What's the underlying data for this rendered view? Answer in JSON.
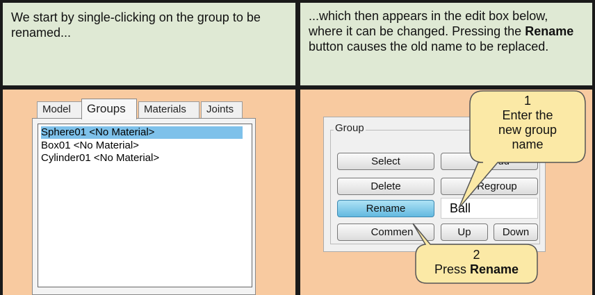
{
  "left_caption": "We start by single-clicking on the group to be renamed...",
  "right_caption": {
    "part1": "...which then appears in the edit box below, where it can be changed. Pressing the ",
    "bold": "Rename",
    "part2": " button causes the old name to be replaced."
  },
  "tabs": [
    "Model",
    "Groups",
    "Materials",
    "Joints"
  ],
  "groups_list": [
    "Sphere01 <No Material>",
    "Box01 <No Material>",
    "Cylinder01 <No Material>"
  ],
  "group_box": {
    "legend": "Group",
    "buttons": {
      "select": "Select",
      "add_partial": "dd",
      "delete": "Delete",
      "regroup_partial": "Regroup",
      "rename": "Rename",
      "comment_partial": "Commen",
      "up": "Up",
      "down": "Down"
    },
    "edit_value": "Ball"
  },
  "callout1": {
    "number": "1",
    "line1": "Enter the",
    "line2": "new group",
    "line3": "name"
  },
  "callout2": {
    "number": "2",
    "prefix": "Press ",
    "bold": "Rename"
  },
  "colors": {
    "caption_bg": "#dfe9d4",
    "content_bg": "#f8caa0",
    "callout_fill": "#fbe9a6",
    "selection": "#7ec1ea"
  }
}
